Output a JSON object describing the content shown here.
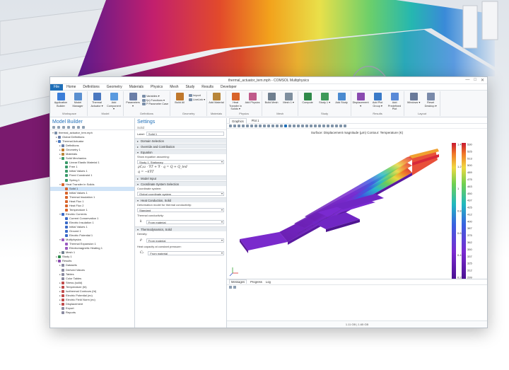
{
  "window": {
    "title": "thermal_actuator_tem.mph - COMSOL Multiphysics",
    "controls": [
      "—",
      "□",
      "✕"
    ]
  },
  "menu": [
    "File",
    "Home",
    "Definitions",
    "Geometry",
    "Materials",
    "Physics",
    "Mesh",
    "Study",
    "Results",
    "Developer"
  ],
  "ribbon": {
    "groups": [
      {
        "name": "Workspace",
        "buttons": [
          {
            "label": "Application Builder",
            "color": "#3b7dd8"
          },
          {
            "label": "Model Manager",
            "color": "#5a8fd0"
          }
        ]
      },
      {
        "name": "Model",
        "buttons": [
          {
            "label": "Thermal Actuator ▾",
            "color": "#4a78c0"
          },
          {
            "label": "Add Component ▾",
            "color": "#5a9adf"
          }
        ]
      },
      {
        "name": "Definitions",
        "buttons": [
          {
            "label": "Parameters ▾",
            "color": "#6b7fa8"
          }
        ],
        "small": [
          "Variables ▾",
          "f(x) Functions ▾",
          "P Parameter Case"
        ]
      },
      {
        "name": "Geometry",
        "buttons": [
          {
            "label": "Build All",
            "color": "#c0782c"
          }
        ],
        "small": [
          "Import",
          "LiveLink ▾"
        ]
      },
      {
        "name": "Materials",
        "buttons": [
          {
            "label": "Add Material",
            "color": "#b8863a"
          }
        ]
      },
      {
        "name": "Physics",
        "buttons": [
          {
            "label": "Heat Transfer in Solids ▾",
            "color": "#d8642a"
          },
          {
            "label": "Add Physics",
            "color": "#c05a8a"
          }
        ]
      },
      {
        "name": "Mesh",
        "buttons": [
          {
            "label": "Build Mesh",
            "color": "#6f7f8f"
          },
          {
            "label": "Mesh 1 ▾",
            "color": "#7f8f9f"
          }
        ]
      },
      {
        "name": "Study",
        "buttons": [
          {
            "label": "Compute",
            "color": "#2f8a4a"
          },
          {
            "label": "Study 1 ▾",
            "color": "#3f9a5a"
          },
          {
            "label": "Add Study",
            "color": "#4a8ad0"
          }
        ]
      },
      {
        "name": "Results",
        "buttons": [
          {
            "label": "Displacement ▾",
            "color": "#8a4ab0"
          },
          {
            "label": "Add Plot Group ▾",
            "color": "#3a7ac8"
          },
          {
            "label": "Add Predefined Plot",
            "color": "#5a8ad8"
          }
        ]
      },
      {
        "name": "Layout",
        "buttons": [
          {
            "label": "Windows ▾",
            "color": "#6a7a9a"
          },
          {
            "label": "Reset Desktop ▾",
            "color": "#7a8aaa"
          }
        ]
      }
    ]
  },
  "model_builder": {
    "title": "Model Builder",
    "tree": [
      {
        "label": "thermal_actuator_tem.mph",
        "lvl": 0,
        "tw": "▾",
        "color": "#7a8ea8"
      },
      {
        "label": "Global Definitions",
        "lvl": 1,
        "tw": "▸",
        "color": "#6b7fa8"
      },
      {
        "label": "Thermal Actuator",
        "lvl": 1,
        "tw": "▾",
        "color": "#4a78c0"
      },
      {
        "label": "Definitions",
        "lvl": 2,
        "tw": "▸",
        "color": "#6b7fa8"
      },
      {
        "label": "Geometry 1",
        "lvl": 2,
        "tw": "▸",
        "color": "#c0782c"
      },
      {
        "label": "Materials",
        "lvl": 2,
        "tw": "▸",
        "color": "#b8863a"
      },
      {
        "label": "Solid Mechanics",
        "lvl": 2,
        "tw": "▾",
        "color": "#3a9a6a"
      },
      {
        "label": "Linear Elastic Material 1",
        "lvl": 3,
        "tw": "",
        "color": "#3a9a6a"
      },
      {
        "label": "Free 1",
        "lvl": 3,
        "tw": "",
        "color": "#3a9a6a"
      },
      {
        "label": "Initial Values 1",
        "lvl": 3,
        "tw": "",
        "color": "#3a9a6a"
      },
      {
        "label": "Fixed Constraint 1",
        "lvl": 3,
        "tw": "",
        "color": "#3a9a6a"
      },
      {
        "label": "Spring 1",
        "lvl": 3,
        "tw": "",
        "color": "#3a9a6a"
      },
      {
        "label": "Heat Transfer in Solids",
        "lvl": 2,
        "tw": "▾",
        "color": "#d8642a"
      },
      {
        "label": "Solid 1",
        "lvl": 3,
        "tw": "",
        "color": "#d8642a",
        "sel": true
      },
      {
        "label": "Initial Values 1",
        "lvl": 3,
        "tw": "",
        "color": "#d8642a"
      },
      {
        "label": "Thermal Insulation 1",
        "lvl": 3,
        "tw": "",
        "color": "#d8642a"
      },
      {
        "label": "Heat Flux 1",
        "lvl": 3,
        "tw": "",
        "color": "#d8642a"
      },
      {
        "label": "Heat Flux 2",
        "lvl": 3,
        "tw": "",
        "color": "#d8642a"
      },
      {
        "label": "Temperature 1",
        "lvl": 3,
        "tw": "",
        "color": "#d8642a"
      },
      {
        "label": "Electric Currents",
        "lvl": 2,
        "tw": "▾",
        "color": "#3a6ac8"
      },
      {
        "label": "Current Conservation 1",
        "lvl": 3,
        "tw": "",
        "color": "#3a6ac8"
      },
      {
        "label": "Electric Insulation 1",
        "lvl": 3,
        "tw": "",
        "color": "#3a6ac8"
      },
      {
        "label": "Initial Values 1",
        "lvl": 3,
        "tw": "",
        "color": "#3a6ac8"
      },
      {
        "label": "Ground 1",
        "lvl": 3,
        "tw": "",
        "color": "#3a6ac8"
      },
      {
        "label": "Electric Potential 1",
        "lvl": 3,
        "tw": "",
        "color": "#3a6ac8"
      },
      {
        "label": "Multiphysics",
        "lvl": 2,
        "tw": "▾",
        "color": "#9a5ac0"
      },
      {
        "label": "Thermal Expansion 1",
        "lvl": 3,
        "tw": "",
        "color": "#9a5ac0"
      },
      {
        "label": "Electromagnetic Heating 1",
        "lvl": 3,
        "tw": "",
        "color": "#9a5ac0"
      },
      {
        "label": "Mesh 1",
        "lvl": 2,
        "tw": "▸",
        "color": "#6f7f8f"
      },
      {
        "label": "Study 1",
        "lvl": 1,
        "tw": "▸",
        "color": "#2f8a4a"
      },
      {
        "label": "Results",
        "lvl": 1,
        "tw": "▾",
        "color": "#8a4ab0"
      },
      {
        "label": "Datasets",
        "lvl": 2,
        "tw": "▸",
        "color": "#8a8aa0"
      },
      {
        "label": "Derived Values",
        "lvl": 2,
        "tw": "",
        "color": "#8a8aa0"
      },
      {
        "label": "Tables",
        "lvl": 2,
        "tw": "▸",
        "color": "#8a8aa0"
      },
      {
        "label": "Color Tables",
        "lvl": 2,
        "tw": "",
        "color": "#8a8aa0"
      },
      {
        "label": "Stress (solid)",
        "lvl": 2,
        "tw": "▸",
        "color": "#c04a4a"
      },
      {
        "label": "Temperature (ht)",
        "lvl": 2,
        "tw": "▸",
        "color": "#c04a4a"
      },
      {
        "label": "Isothermal Contours (ht)",
        "lvl": 2,
        "tw": "▸",
        "color": "#c04a4a"
      },
      {
        "label": "Electric Potential (ec)",
        "lvl": 2,
        "tw": "▸",
        "color": "#c04a4a"
      },
      {
        "label": "Electric Field Norm (ec)",
        "lvl": 2,
        "tw": "▸",
        "color": "#c04a4a"
      },
      {
        "label": "Displacement",
        "lvl": 2,
        "tw": "▸",
        "color": "#c04a4a"
      },
      {
        "label": "Export",
        "lvl": 2,
        "tw": "",
        "color": "#8a8aa0"
      },
      {
        "label": "Reports",
        "lvl": 2,
        "tw": "",
        "color": "#8a8aa0"
      }
    ]
  },
  "settings": {
    "title": "Settings",
    "subtitle": "Solid",
    "label_caption": "Label:",
    "label_value": "Solid 1",
    "s_domain": "Domain Selection",
    "s_override": "Override and Contribution",
    "s_equation": "Equation",
    "eq_caption": "Show equation assuming:",
    "eq_value": "Study 1, Stationary",
    "eq_line1": "ρCₚu · ∇T + ∇ · q = Q + Q_ted",
    "eq_line2": "q = −k∇T",
    "s_model_input": "Model Input",
    "s_coord": "Coordinate System Selection",
    "coord_caption": "Coordinate system:",
    "coord_value": "Global coordinate system",
    "s_heat": "Heat Conduction, Solid",
    "heat_caption": "Deformation model for thermal conductivity:",
    "heat_value": "Standard",
    "k_caption": "Thermal conductivity:",
    "k_symbol": "k",
    "k_value": "From material",
    "s_thermo": "Thermodynamics, Solid",
    "rho_caption": "Density:",
    "rho_symbol": "ρ",
    "rho_value": "From material",
    "cp_caption": "Heat capacity at constant pressure:",
    "cp_symbol": "Cₚ",
    "cp_value": "From material"
  },
  "graphics": {
    "tab_graphics": "Graphics",
    "tab_plot": "Plot 1",
    "plot_title": "Surface: Displacement magnitude (µm)  Contour: Temperature (K)",
    "colorbar_left": {
      "ticks": [
        "1.4",
        "1.2",
        "1",
        "0.8",
        "0.6",
        "0.4",
        "0.2"
      ],
      "min": 0,
      "max": 1.5
    },
    "colorbar_right": {
      "ticks": [
        "530",
        "525",
        "513",
        "500",
        "489",
        "475",
        "463",
        "450",
        "437",
        "425",
        "412",
        "400",
        "387",
        "375",
        "362",
        "350",
        "337",
        "325",
        "312",
        "299"
      ],
      "min": 299,
      "max": 530
    }
  },
  "messages": {
    "tabs": [
      "Messages",
      "Progress",
      "Log"
    ]
  },
  "status_bar": {
    "memory": "1.11 GB | 1.65 GB"
  },
  "colors": {
    "accent": "#1f6fb8",
    "selection": "#cfe3f7"
  }
}
